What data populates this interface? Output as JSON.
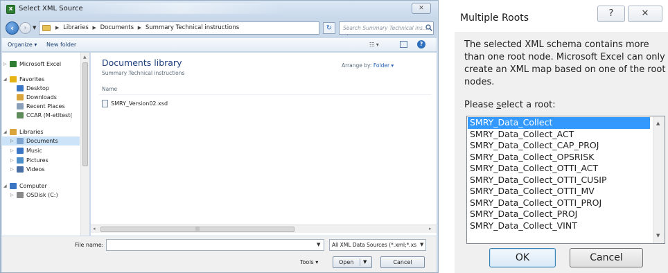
{
  "select_xml_source": {
    "title": "Select XML Source",
    "close_label": "✕",
    "breadcrumbs": [
      "Libraries",
      "Documents",
      "Summary Technical instructions"
    ],
    "search_placeholder": "Search Summary Technical ins...",
    "toolbar": {
      "organize": "Organize ▾",
      "new_folder": "New folder"
    },
    "nav_tree": [
      {
        "label": "Microsoft Excel",
        "icon": "excel-icon",
        "color": "#2e7d32",
        "arrow": "▷"
      },
      {
        "label": "Favorites",
        "icon": "star-icon",
        "color": "#e7b416",
        "arrow": "◢"
      },
      {
        "label": "Desktop",
        "icon": "desktop-icon",
        "color": "#3a76c4",
        "arrow": ""
      },
      {
        "label": "Downloads",
        "icon": "downloads-icon",
        "color": "#d9a43b",
        "arrow": ""
      },
      {
        "label": "Recent Places",
        "icon": "recent-places-icon",
        "color": "#8aa0b8",
        "arrow": ""
      },
      {
        "label": "CCAR (M-etltest(",
        "icon": "network-drive-icon",
        "color": "#5f8c5a",
        "arrow": ""
      },
      {
        "label": "Libraries",
        "icon": "libraries-icon",
        "color": "#d9a43b",
        "arrow": "◢"
      },
      {
        "label": "Documents",
        "icon": "documents-icon",
        "color": "#7da3cf",
        "arrow": "▷",
        "selected": true
      },
      {
        "label": "Music",
        "icon": "music-icon",
        "color": "#3a76c4",
        "arrow": "▷"
      },
      {
        "label": "Pictures",
        "icon": "pictures-icon",
        "color": "#4f8fc9",
        "arrow": "▷"
      },
      {
        "label": "Videos",
        "icon": "videos-icon",
        "color": "#4a6fa5",
        "arrow": "▷"
      },
      {
        "label": "Computer",
        "icon": "computer-icon",
        "color": "#3a76c4",
        "arrow": "◢"
      },
      {
        "label": "OSDisk (C:)",
        "icon": "disk-icon",
        "color": "#8a8a8a",
        "arrow": "▷"
      }
    ],
    "library_title": "Documents library",
    "library_subtitle": "Summary Technical instructions",
    "arrange_label": "Arrange by:",
    "arrange_value": "Folder ▾",
    "column_name": "Name",
    "files": [
      "SMRY_Version02.xsd"
    ],
    "file_name_label": "File name:",
    "file_name_value": "",
    "filter_value": "All XML Data Sources (*.xml;*.xs",
    "tools_label": "Tools ▾",
    "open_label": "Open",
    "cancel_label": "Cancel"
  },
  "multiple_roots": {
    "title": "Multiple Roots",
    "help_label": "?",
    "close_label": "✕",
    "message": "The selected XML schema contains more than one root node. Microsoft Excel can only create an XML map based on one of the root nodes.",
    "prompt_before": "Please ",
    "prompt_underline": "s",
    "prompt_after": "elect a root:",
    "roots": [
      "SMRY_Data_Collect",
      "SMRY_Data_Collect_ACT",
      "SMRY_Data_Collect_CAP_PROJ",
      "SMRY_Data_Collect_OPSRISK",
      "SMRY_Data_Collect_OTTI_ACT",
      "SMRY_Data_Collect_OTTI_CUSIP",
      "SMRY_Data_Collect_OTTI_MV",
      "SMRY_Data_Collect_OTTI_PROJ",
      "SMRY_Data_Collect_PROJ",
      "SMRY_Data_Collect_VINT"
    ],
    "selected_index": 0,
    "ok_label": "OK",
    "cancel_label": "Cancel",
    "selection_color": "#3399ff"
  }
}
